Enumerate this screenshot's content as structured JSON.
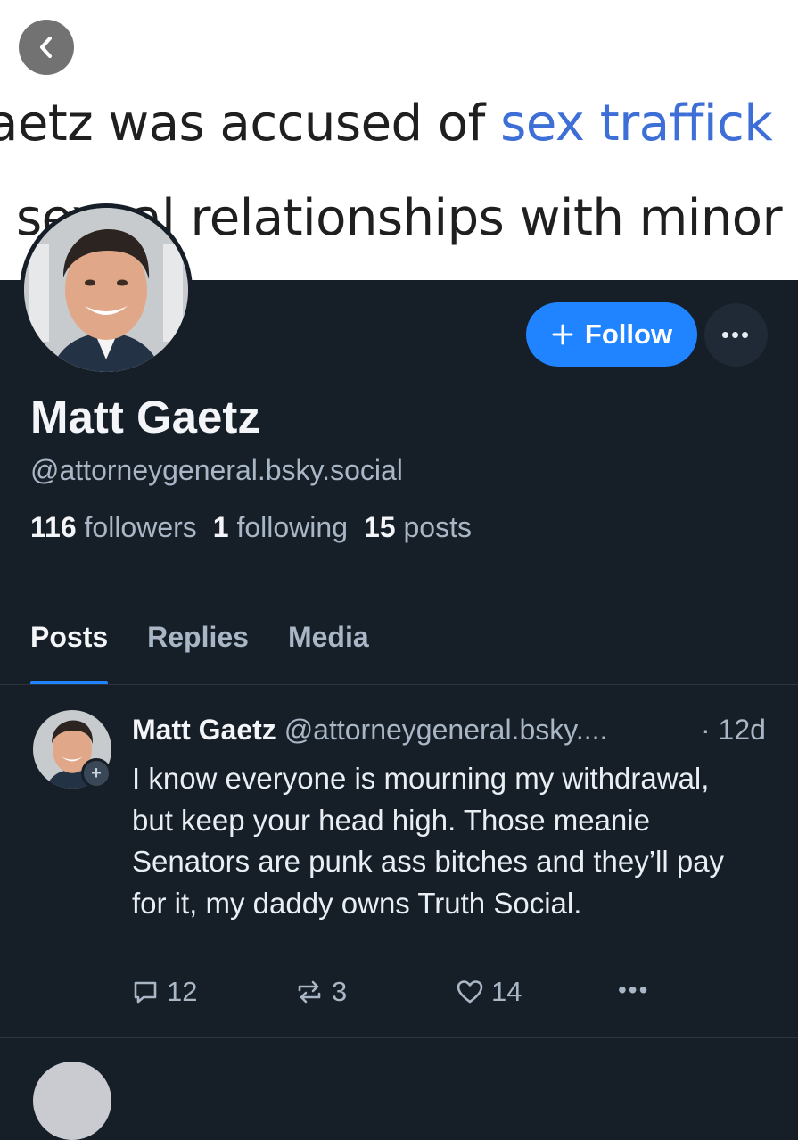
{
  "banner": {
    "line1_prefix": "aetz was accused of ",
    "line1_link": "sex traffick",
    "line2": "sexual relationships with minor"
  },
  "profile": {
    "display_name": "Matt Gaetz",
    "handle": "@attorneygeneral.bsky.social",
    "follow_label": "Follow",
    "more_label": "•••",
    "stats": {
      "followers_count": "116",
      "followers_label": "followers",
      "following_count": "1",
      "following_label": "following",
      "posts_count": "15",
      "posts_label": "posts"
    }
  },
  "tabs": [
    {
      "label": "Posts",
      "active": true
    },
    {
      "label": "Replies",
      "active": false
    },
    {
      "label": "Media",
      "active": false
    }
  ],
  "post": {
    "author": "Matt Gaetz",
    "handle": "@attorneygeneral.bsky....",
    "time": "· 12d",
    "text": "I know everyone is mourning my withdrawal, but keep your head high. Those meanie Senators are punk ass bitches and they’ll pay for it, my daddy owns Truth Social.",
    "replies": "12",
    "reposts": "3",
    "likes": "14",
    "more": "•••"
  },
  "colors": {
    "background": "#161e27",
    "accent": "#2083ff",
    "link": "#3d6fd6"
  }
}
